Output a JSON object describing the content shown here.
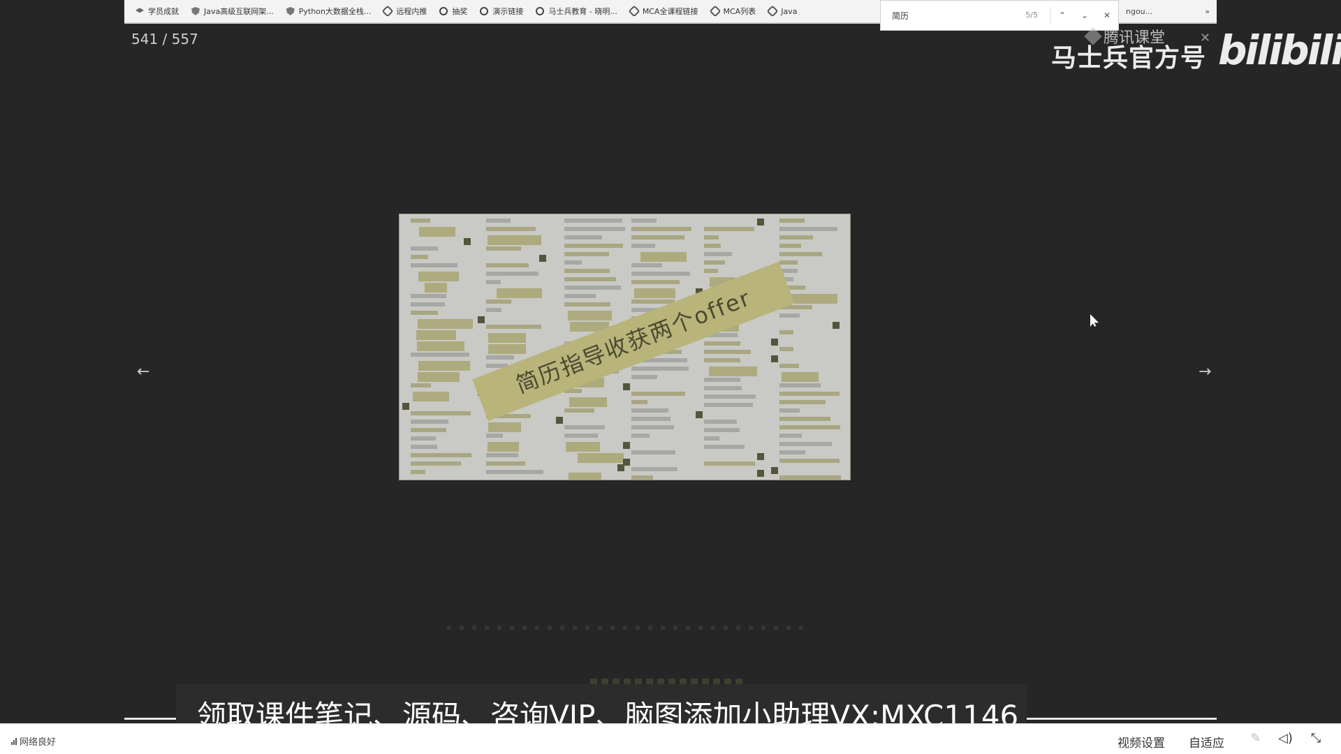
{
  "bookmarks": [
    {
      "label": "学员成就",
      "icon": "hat-icon"
    },
    {
      "label": "Java高级互联网架...",
      "icon": "shield-icon"
    },
    {
      "label": "Python大数据全栈...",
      "icon": "shield-icon"
    },
    {
      "label": "远程内推",
      "icon": "link-icon"
    },
    {
      "label": "抽奖",
      "icon": "globe-icon"
    },
    {
      "label": "演示链接",
      "icon": "globe-icon"
    },
    {
      "label": "马士兵教育 - 晓明...",
      "icon": "globe-icon"
    },
    {
      "label": "MCA全课程链接",
      "icon": "link-icon"
    },
    {
      "label": "MCA列表",
      "icon": "link-icon"
    },
    {
      "label": "Java",
      "icon": "link-icon"
    }
  ],
  "find_bar": {
    "query": "简历",
    "count": "5/5",
    "prev": "⌃",
    "next": "⌄",
    "close": "✕"
  },
  "tail": {
    "text": "ngou...",
    "more": "»"
  },
  "page_counter": "541 / 557",
  "watermark": {
    "small": "腾讯课堂",
    "close": "✕",
    "main": "马士兵官方号",
    "logo": "bilibili"
  },
  "nav": {
    "prev": "←",
    "next": "→"
  },
  "slide": {
    "banner": "简历指导收获两个offer"
  },
  "subtitle": "领取课件笔记、源码、咨询VIP、脑图添加小助理VX:MXC1146",
  "status": {
    "network": "网络良好",
    "video_settings": "视频设置",
    "auto_fit": "自适应"
  },
  "colors": {
    "background": "#262626",
    "banner": "#b8b47a",
    "slide_bg": "#c9c9c5"
  }
}
